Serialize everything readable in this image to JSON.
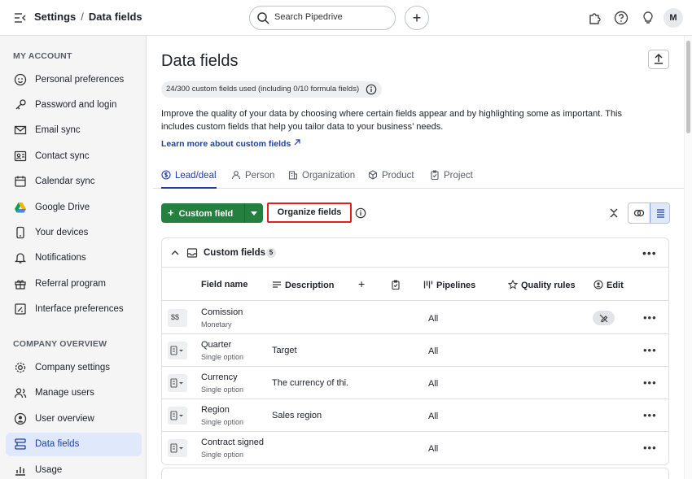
{
  "topbar": {
    "breadcrumb_root": "Settings",
    "breadcrumb_sep": "/",
    "breadcrumb_current": "Data fields",
    "search_placeholder": "Search Pipedrive",
    "add_label": "+",
    "avatar_initial": "M"
  },
  "sidebar": {
    "section_account": "MY ACCOUNT",
    "account_items": [
      {
        "label": "Personal preferences",
        "icon": "smiley-icon"
      },
      {
        "label": "Password and login",
        "icon": "key-icon"
      },
      {
        "label": "Email sync",
        "icon": "mail-icon"
      },
      {
        "label": "Contact sync",
        "icon": "contact-card-icon"
      },
      {
        "label": "Calendar sync",
        "icon": "calendar-icon"
      },
      {
        "label": "Google Drive",
        "icon": "google-drive-icon"
      },
      {
        "label": "Your devices",
        "icon": "phone-icon"
      },
      {
        "label": "Notifications",
        "icon": "bell-icon"
      },
      {
        "label": "Referral program",
        "icon": "gift-icon"
      },
      {
        "label": "Interface preferences",
        "icon": "interface-icon"
      }
    ],
    "section_company": "COMPANY OVERVIEW",
    "company_items": [
      {
        "label": "Company settings",
        "icon": "gear-icon"
      },
      {
        "label": "Manage users",
        "icon": "users-icon"
      },
      {
        "label": "User overview",
        "icon": "user-circle-icon"
      },
      {
        "label": "Data fields",
        "icon": "data-fields-icon",
        "active": true
      },
      {
        "label": "Usage",
        "icon": "usage-icon"
      }
    ]
  },
  "main": {
    "title": "Data fields",
    "usage_text": "24/300 custom fields used (including 0/10 formula fields)",
    "description": "Improve the quality of your data by choosing where certain fields appear and by highlighting some as important. This includes custom fields that help you tailor data to your business’ needs.",
    "learn_more": "Learn more about custom fields",
    "tabs": [
      {
        "label": "Lead/deal",
        "active": true
      },
      {
        "label": "Person"
      },
      {
        "label": "Organization"
      },
      {
        "label": "Product"
      },
      {
        "label": "Project"
      }
    ],
    "custom_field_button": "Custom field",
    "organize_button": "Organize fields",
    "accent_color": "#258040",
    "link_color": "#1d3fa8",
    "highlight_color": "#e0201b"
  },
  "table": {
    "title": "Custom fields",
    "count": "5",
    "columns": {
      "field_name": "Field name",
      "description": "Description",
      "pipelines": "Pipelines",
      "quality_rules": "Quality rules",
      "edit": "Edit"
    },
    "rows": [
      {
        "name": "Comission",
        "type": "Monetary",
        "description": "",
        "pipelines": "All",
        "type_icon": "$$",
        "editable": false
      },
      {
        "name": "Quarter",
        "type": "Single option",
        "description": "Target",
        "pipelines": "All"
      },
      {
        "name": "Currency",
        "type": "Single option",
        "description": "The currency of thi.",
        "pipelines": "All"
      },
      {
        "name": "Region",
        "type": "Single option",
        "description": "Sales region",
        "pipelines": "All"
      },
      {
        "name": "Contract signed",
        "type": "Single option",
        "description": "",
        "pipelines": "All"
      }
    ]
  }
}
